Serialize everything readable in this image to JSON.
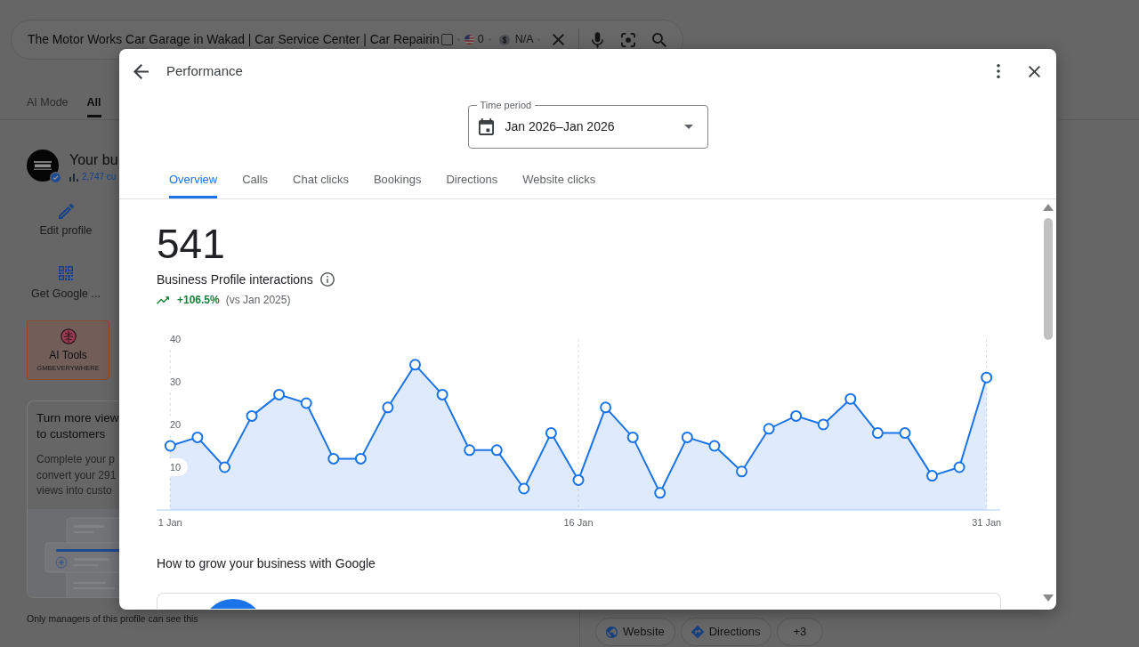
{
  "search": {
    "query": "The Motor Works Car Garage in Wakad | Car Service Center | Car Repairin",
    "checked": false,
    "flag_count": "0",
    "price": "N/A"
  },
  "search_tabs": [
    {
      "label": "AI Mode",
      "selected": false
    },
    {
      "label": "All",
      "selected": true
    }
  ],
  "business": {
    "title": "Your bu",
    "views": "2,747 cu",
    "actions": [
      {
        "kind": "edit",
        "label": "Edit profile"
      },
      {
        "kind": "qr",
        "label": "Get Google ..."
      }
    ],
    "ai_tools": {
      "title": "AI Tools",
      "subtitle": "GMBEVERYWHERE"
    },
    "promo": {
      "title_lines": [
        "Turn more view",
        "to customers"
      ],
      "body_lines": [
        "Complete your p",
        "convert your 291",
        "views into custo"
      ]
    },
    "note": "Only managers of this profile can see this"
  },
  "chips": [
    {
      "kind": "website",
      "label": "Website"
    },
    {
      "kind": "directions",
      "label": "Directions"
    },
    {
      "kind": "more",
      "label": "+3"
    }
  ],
  "dialog": {
    "title": "Performance",
    "time_period": {
      "label": "Time period",
      "value": "Jan 2026–Jan 2026"
    },
    "tabs": [
      {
        "label": "Overview",
        "selected": true
      },
      {
        "label": "Calls",
        "selected": false
      },
      {
        "label": "Chat clicks",
        "selected": false
      },
      {
        "label": "Bookings",
        "selected": false
      },
      {
        "label": "Directions",
        "selected": false
      },
      {
        "label": "Website clicks",
        "selected": false
      }
    ],
    "total": "541",
    "metric": "Business Profile interactions",
    "change": "+106.5%",
    "comparison": "(vs Jan 2025)",
    "chart_data": {
      "type": "area",
      "categories": [
        "1 Jan",
        null,
        null,
        null,
        null,
        null,
        null,
        null,
        null,
        null,
        null,
        null,
        null,
        null,
        null,
        "16 Jan",
        null,
        null,
        null,
        null,
        null,
        null,
        null,
        null,
        null,
        null,
        null,
        null,
        null,
        null,
        "31 Jan"
      ],
      "ylim": [
        0,
        40
      ],
      "yticks": [
        10,
        20,
        30,
        40
      ],
      "grid": true,
      "series": [
        {
          "color": "#1a73e8",
          "values": [
            15,
            17,
            10,
            22,
            27,
            25,
            12,
            12,
            24,
            34,
            27,
            14,
            14,
            5,
            18,
            7,
            24,
            17,
            4,
            17,
            15,
            9,
            19,
            22,
            20,
            26,
            18,
            18,
            8,
            10,
            31
          ]
        }
      ]
    },
    "section_title": "How to grow your business with Google"
  }
}
